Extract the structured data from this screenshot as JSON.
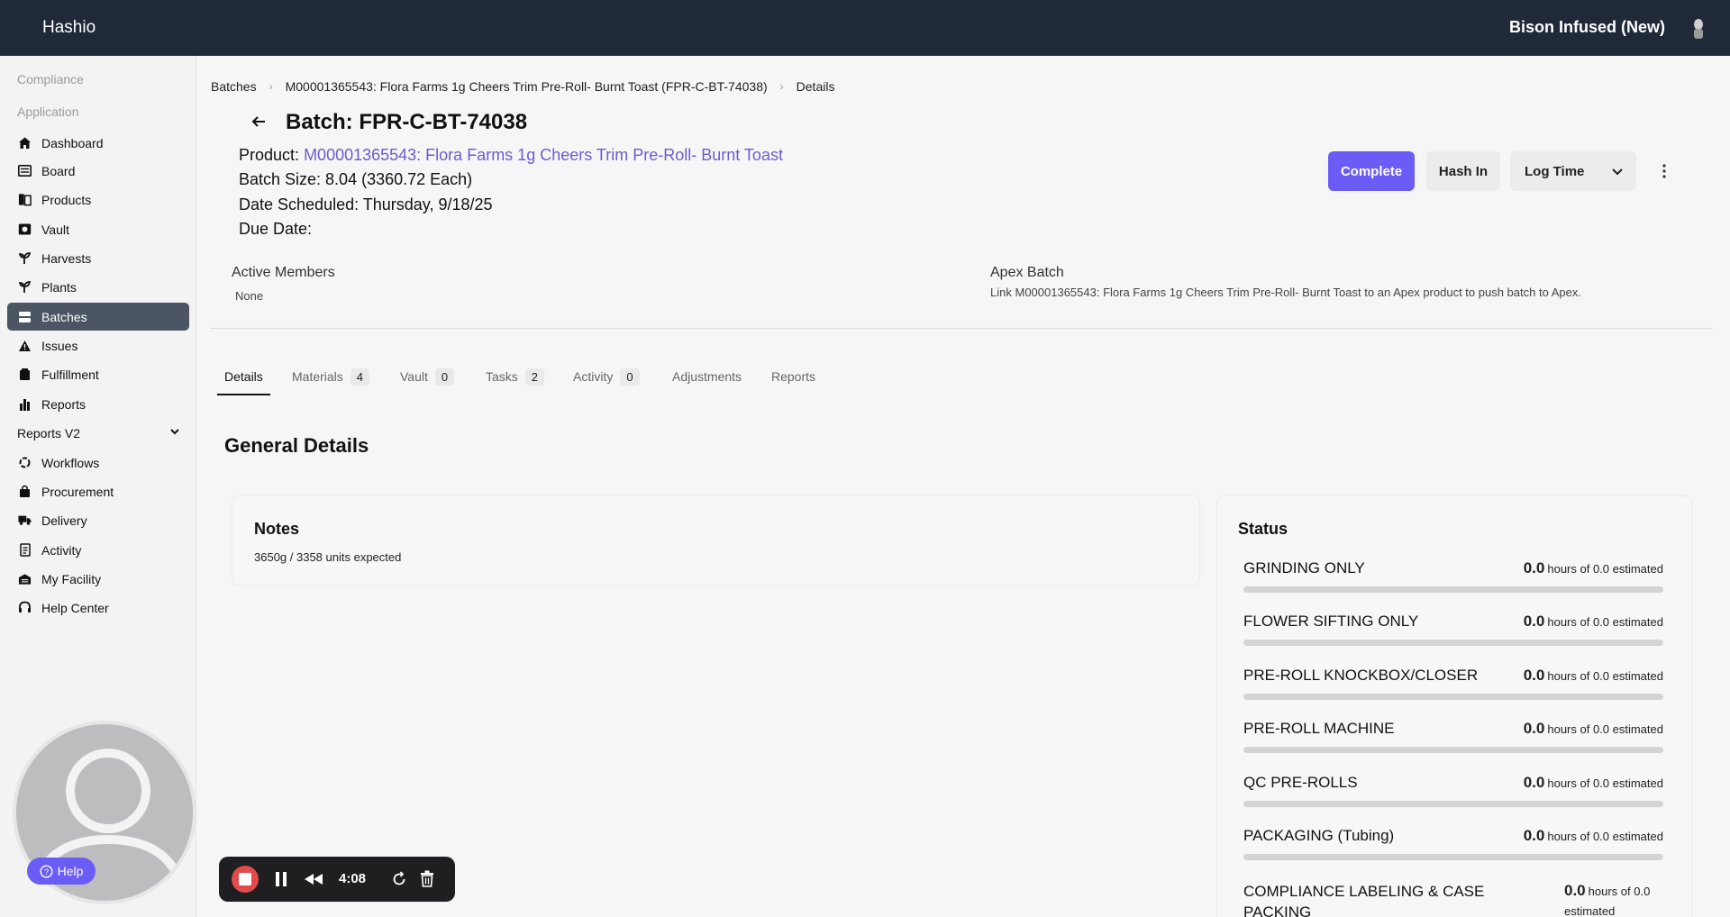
{
  "app": {
    "brand": "Hashio",
    "org": "Bison Infused (New)"
  },
  "sidebar": {
    "sections": {
      "compliance": "Compliance",
      "application": "Application"
    },
    "items": [
      {
        "label": "Dashboard",
        "icon": "home-icon"
      },
      {
        "label": "Board",
        "icon": "board-icon"
      },
      {
        "label": "Products",
        "icon": "products-icon"
      },
      {
        "label": "Vault",
        "icon": "vault-icon"
      },
      {
        "label": "Harvests",
        "icon": "harvest-icon"
      },
      {
        "label": "Plants",
        "icon": "plant-icon"
      },
      {
        "label": "Batches",
        "icon": "batches-icon",
        "active": true
      },
      {
        "label": "Issues",
        "icon": "warning-icon"
      },
      {
        "label": "Fulfillment",
        "icon": "fulfillment-icon"
      },
      {
        "label": "Reports",
        "icon": "bar-chart-icon"
      },
      {
        "label": "Reports V2",
        "icon": "chevron-down-icon"
      },
      {
        "label": "Workflows",
        "icon": "workflow-icon"
      },
      {
        "label": "Procurement",
        "icon": "bag-icon"
      },
      {
        "label": "Delivery",
        "icon": "truck-icon"
      },
      {
        "label": "Activity",
        "icon": "activity-icon"
      },
      {
        "label": "My Facility",
        "icon": "facility-icon"
      },
      {
        "label": "Help Center",
        "icon": "headset-icon"
      }
    ]
  },
  "breadcrumb": {
    "items": [
      "Batches",
      "M00001365543: Flora Farms 1g Cheers Trim Pre-Roll- Burnt Toast (FPR-C-BT-74038)",
      "Details"
    ]
  },
  "batch": {
    "title": "Batch: FPR-C-BT-74038",
    "product_label": "Product:",
    "product_link": "M00001365543: Flora Farms 1g Cheers Trim Pre-Roll- Burnt Toast",
    "batch_size": "Batch Size: 8.04 (3360.72 Each)",
    "date_scheduled": "Date Scheduled: Thursday, 9/18/25",
    "due_date": "Due Date:"
  },
  "actions": {
    "complete": "Complete",
    "hash_in": "Hash In",
    "log_time": "Log Time"
  },
  "members": {
    "label": "Active Members",
    "value": "None"
  },
  "apex": {
    "label": "Apex Batch",
    "prefix": "Link",
    "product": "M00001365543: Flora Farms 1g Cheers Trim Pre-Roll- Burnt Toast",
    "suffix": "to an Apex product to push batch to Apex."
  },
  "tabs": [
    {
      "label": "Details",
      "count": null,
      "active": true
    },
    {
      "label": "Materials",
      "count": "4"
    },
    {
      "label": "Vault",
      "count": "0"
    },
    {
      "label": "Tasks",
      "count": "2"
    },
    {
      "label": "Activity",
      "count": "0"
    },
    {
      "label": "Adjustments",
      "count": null
    },
    {
      "label": "Reports",
      "count": null
    }
  ],
  "general": {
    "title": "General Details",
    "notes_title": "Notes",
    "notes_text": "3650g / 3358 units expected",
    "status_title": "Status"
  },
  "status_items": [
    {
      "name": "GRINDING ONLY",
      "value": "0.0",
      "suffix": "hours of 0.0 estimated",
      "progress": 0
    },
    {
      "name": "FLOWER SIFTING ONLY",
      "value": "0.0",
      "suffix": "hours of 0.0 estimated",
      "progress": 0
    },
    {
      "name": "PRE-ROLL KNOCKBOX/CLOSER",
      "value": "0.0",
      "suffix": "hours of 0.0 estimated",
      "progress": 0
    },
    {
      "name": "PRE-ROLL MACHINE",
      "value": "0.0",
      "suffix": "hours of 0.0 estimated",
      "progress": 0
    },
    {
      "name": "QC PRE-ROLLS",
      "value": "0.0",
      "suffix": "hours of 0.0 estimated",
      "progress": 0
    },
    {
      "name": "PACKAGING (Tubing)",
      "value": "0.0",
      "suffix": "hours of 0.0 estimated",
      "progress": 0
    },
    {
      "name": "COMPLIANCE LABELING & CASE PACKING",
      "value": "0.0",
      "suffix": "hours of 0.0 estimated",
      "progress": 0
    }
  ],
  "help": {
    "label": "Help"
  },
  "recorder": {
    "time": "4:08"
  },
  "colors": {
    "accent": "#6b5cf6",
    "topbar": "#1f2937",
    "sidebar_active": "#4b5563",
    "link": "#6d5bd0"
  }
}
